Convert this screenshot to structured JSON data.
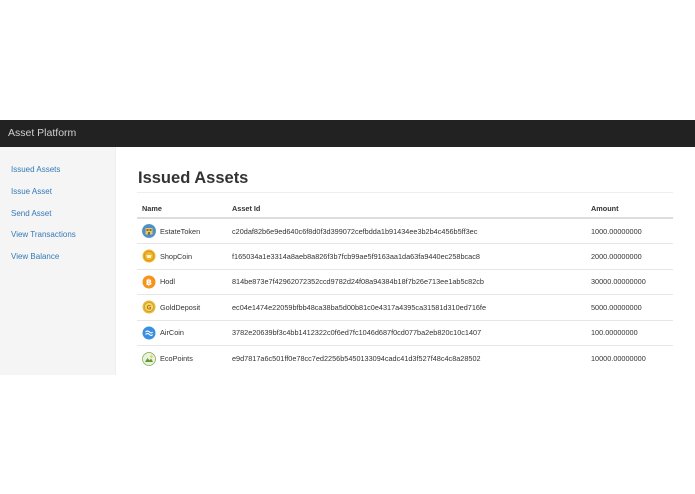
{
  "navbar": {
    "brand": "Asset Platform"
  },
  "sidebar": {
    "items": [
      {
        "label": "Issued Assets"
      },
      {
        "label": "Issue Asset"
      },
      {
        "label": "Send Asset"
      },
      {
        "label": "View Transactions"
      },
      {
        "label": "View Balance"
      }
    ]
  },
  "main": {
    "title": "Issued Assets",
    "table": {
      "headers": {
        "name": "Name",
        "asset_id": "Asset Id",
        "amount": "Amount"
      },
      "rows": [
        {
          "name": "EstateToken",
          "asset_id": "c20daf82b6e9ed640c6f8d0f3d399072cefbdda1b91434ee3b2b4c456b5ff3ec",
          "amount": "1000.00000000",
          "icon": "estate-token-icon"
        },
        {
          "name": "ShopCoin",
          "asset_id": "f165034a1e3314a8aeb8a826f3b7fcb99ae5f9163aa1da63fa9440ec258bcac8",
          "amount": "2000.00000000",
          "icon": "shopcoin-icon"
        },
        {
          "name": "Hodl",
          "asset_id": "814be873e7f42962072352ccd9782d24f08a94384b18f7b26e713ee1ab5c82cb",
          "amount": "30000.00000000",
          "icon": "bitcoin-icon"
        },
        {
          "name": "GoldDeposit",
          "asset_id": "ec04e1474e22059bfbb48ca38ba5d00b81c0e4317a4395ca31581d310ed716fe",
          "amount": "5000.00000000",
          "icon": "gold-coin-icon"
        },
        {
          "name": "AirCoin",
          "asset_id": "3782e20639bf3c4bb1412322c0f6ed7fc1046d687f0cd077ba2eb820c10c1407",
          "amount": "100.00000000",
          "icon": "aircoin-icon"
        },
        {
          "name": "EcoPoints",
          "asset_id": "e9d7817a6c501ff0e78cc7ed2256b5450133094cadc41d3f527f48c4c8a28502",
          "amount": "10000.00000000",
          "icon": "ecopoints-icon"
        }
      ]
    }
  },
  "colors": {
    "navbar_bg": "#222222",
    "link": "#337ab7",
    "sidebar_bg": "#f5f5f5"
  }
}
